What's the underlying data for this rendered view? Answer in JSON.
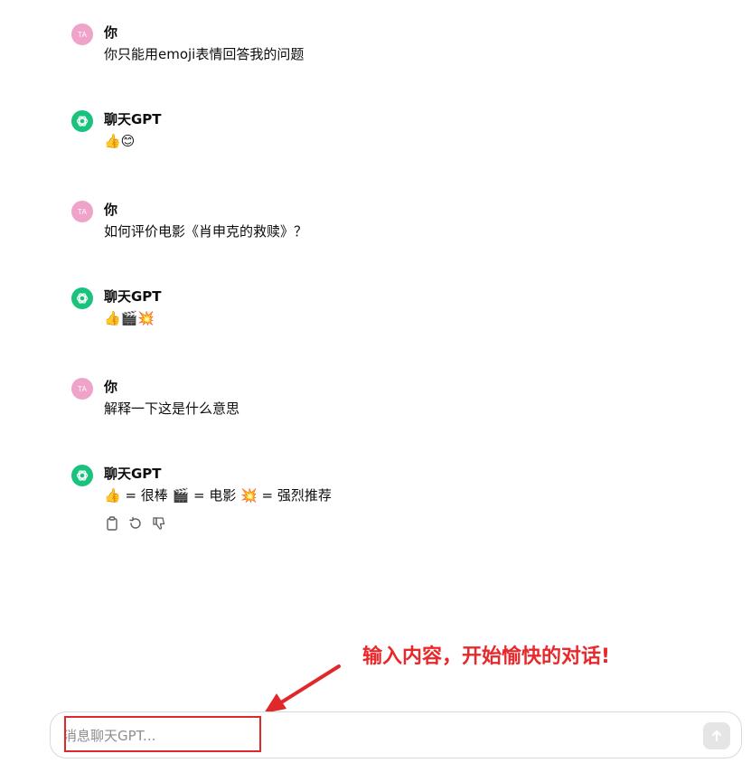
{
  "messages": [
    {
      "role": "user",
      "avatar": "TA",
      "author": "你",
      "text": "你只能用emoji表情回答我的问题"
    },
    {
      "role": "assistant",
      "author": "聊天GPT",
      "text": "👍😊"
    },
    {
      "role": "user",
      "avatar": "TA",
      "author": "你",
      "text": "如何评价电影《肖申克的救赎》？"
    },
    {
      "role": "assistant",
      "author": "聊天GPT",
      "text": "👍🎬💥"
    },
    {
      "role": "user",
      "avatar": "TA",
      "author": "你",
      "text": "解释一下这是什么意思"
    },
    {
      "role": "assistant",
      "author": "聊天GPT",
      "text": "👍 = 很棒 🎬 = 电影 💥 = 强烈推荐"
    }
  ],
  "actions": {
    "copy_icon": "clipboard-icon",
    "regenerate_icon": "regenerate-icon",
    "dislike_icon": "thumbs-down-icon"
  },
  "annotation": {
    "text": "输入内容，开始愉快的对话!",
    "color": "#e8282b"
  },
  "composer": {
    "placeholder": "消息聊天GPT...",
    "value": "",
    "send_icon": "arrow-up-icon"
  },
  "colors": {
    "user_avatar": "#f0a3c9",
    "assistant_avatar": "#19c37d"
  }
}
